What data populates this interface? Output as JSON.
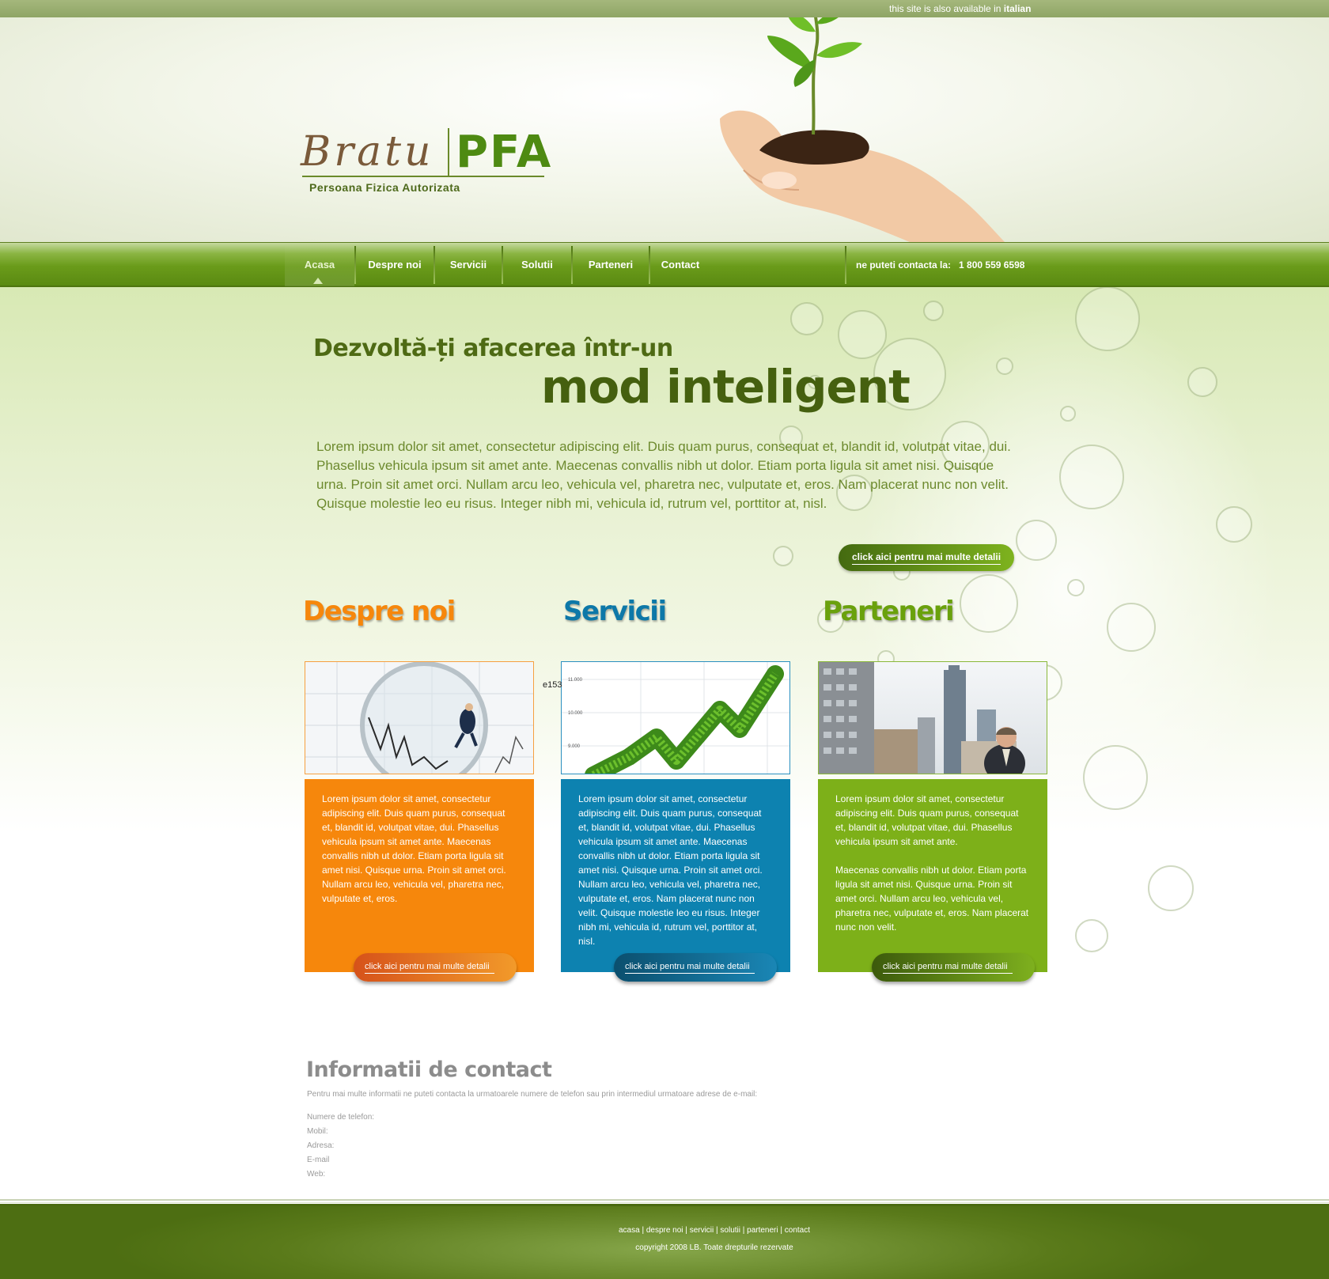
{
  "topbar": {
    "lang_prefix": "this site is also available in",
    "lang_link": "italian"
  },
  "logo": {
    "word1": "Bratu",
    "word2": "PFA",
    "subtitle": "Persoana Fizica Autorizata"
  },
  "nav": {
    "items": [
      {
        "label": "Acasa"
      },
      {
        "label": "Despre noi"
      },
      {
        "label": "Servicii"
      },
      {
        "label": "Solutii"
      },
      {
        "label": "Parteneri"
      },
      {
        "label": "Contact"
      }
    ],
    "phone_label": "ne puteti contacta la:",
    "phone_number": "1 800 559 6598"
  },
  "hero": {
    "title_line1": "Dezvoltă-ți afacerea într-un",
    "title_line2": "mod inteligent",
    "text": "Lorem ipsum dolor sit amet, consectetur adipiscing elit. Duis quam purus, consequat et, blandit id, volutpat vitae, dui. Phasellus vehicula ipsum sit amet ante. Maecenas convallis nibh ut dolor. Etiam porta ligula sit amet nisi. Quisque urna. Proin sit amet orci. Nullam arcu leo, vehicula vel, pharetra nec, vulputate et, eros. Nam placerat nunc non velit. Quisque molestie leo eu risus. Integer nibh mi, vehicula id, rutrum vel, porttitor at, nisl.",
    "button": "click aici pentru mai multe detalii"
  },
  "columns": [
    {
      "title": "Despre noi",
      "color": "#f6870c",
      "paragraphs": [
        "Lorem ipsum dolor sit amet, consectetur adipiscing elit. Duis quam purus, consequat et, blandit id, volutpat vitae, dui. Phasellus vehicula ipsum sit amet ante. Maecenas convallis nibh ut dolor. Etiam porta ligula sit amet nisi. Quisque urna. Proin sit amet orci. Nullam arcu leo, vehicula vel, pharetra nec, vulputate et, eros."
      ],
      "button": "click aici pentru mai multe detalii"
    },
    {
      "title": "Servicii",
      "color": "#0d82b0",
      "paragraphs": [
        "Lorem ipsum dolor sit amet, consectetur adipiscing elit. Duis quam purus, consequat et, blandit id, volutpat vitae, dui. Phasellus vehicula ipsum sit amet ante. Maecenas convallis nibh ut dolor. Etiam porta ligula sit amet nisi. Quisque urna. Proin sit amet orci. Nullam arcu leo, vehicula vel, pharetra nec, vulputate et, eros. Nam placerat nunc non velit. Quisque molestie leo eu risus. Integer nibh mi, vehicula id, rutrum vel, porttitor at, nisl."
      ],
      "button": "click aici pentru mai multe detalii",
      "chart_ticks": [
        "11.000",
        "10.000",
        "9.000"
      ]
    },
    {
      "title": "Parteneri",
      "color": "#7db019",
      "paragraphs": [
        "Lorem ipsum dolor sit amet, consectetur adipiscing elit. Duis quam purus, consequat et, blandit id, volutpat vitae, dui. Phasellus vehicula ipsum sit amet ante.",
        "Maecenas convallis nibh ut dolor. Etiam porta ligula sit amet nisi. Quisque urna. Proin sit amet orci. Nullam arcu leo, vehicula vel, pharetra nec, vulputate et, eros. Nam placerat nunc non velit."
      ],
      "button": "click aici pentru mai multe detalii"
    }
  ],
  "stray_label": "e153",
  "contact": {
    "title": "Informatii de contact",
    "intro": "Pentru mai multe informatii ne puteti contacta la urmatoarele numere de telefon sau prin intermediul urmatoare adrese de e-mail:",
    "fields": [
      "Numere de telefon:",
      "Mobil:",
      "Adresa:",
      "E-mail",
      "Web:"
    ]
  },
  "footer": {
    "links": [
      "acasa",
      "despre noi",
      "servicii",
      "solutii",
      "parteneri",
      "contact"
    ],
    "copyright": "copyright 2008 LB. Toate drepturile rezervate"
  }
}
